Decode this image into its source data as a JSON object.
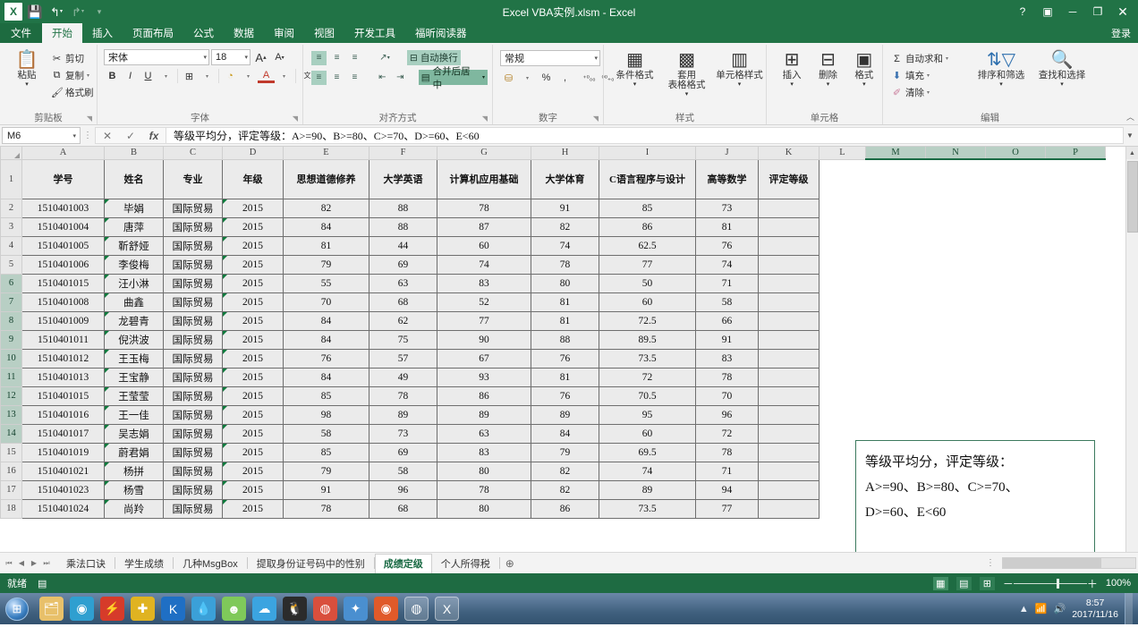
{
  "titlebar": {
    "app_icon": "excel-logo",
    "quick_access": [
      "save-icon",
      "undo-icon",
      "redo-icon",
      "customize-qat-icon"
    ],
    "title": "Excel VBA实例.xlsm - Excel",
    "help": "?",
    "ribbon_display": "▣",
    "minimize": "－",
    "restore": "❐",
    "close": "✕"
  },
  "ribbon": {
    "file_tab": "文件",
    "tabs": [
      "开始",
      "插入",
      "页面布局",
      "公式",
      "数据",
      "审阅",
      "视图",
      "开发工具",
      "福昕阅读器"
    ],
    "active_tab": "开始",
    "signin": "登录",
    "groups": {
      "clipboard": {
        "label": "剪贴板",
        "paste": "粘贴",
        "cut": "剪切",
        "copy": "复制",
        "format_painter": "格式刷"
      },
      "font": {
        "label": "字体",
        "font_name": "宋体",
        "font_size": "18",
        "grow": "A",
        "shrink": "A",
        "bold": "B",
        "italic": "I",
        "underline": "U",
        "border": "⊞",
        "fill": "🎨",
        "font_color": "A",
        "phonetic": "wén"
      },
      "alignment": {
        "label": "对齐方式",
        "wrap_text": "自动换行",
        "merge_center": "合并后居中",
        "orientation": "↗"
      },
      "number": {
        "label": "数字",
        "format": "常规",
        "accounting": "¤",
        "percent": "%",
        "comma": ",",
        "increase_decimal": "←.0",
        "decrease_decimal": ".00→"
      },
      "styles": {
        "label": "样式",
        "conditional_formatting": "条件格式",
        "format_as_table": "套用\n表格格式",
        "cell_styles": "单元格样式"
      },
      "cells": {
        "label": "单元格",
        "insert": "插入",
        "delete": "删除",
        "format": "格式"
      },
      "editing": {
        "label": "编辑",
        "autosum": "自动求和",
        "fill": "填充",
        "clear": "清除",
        "sort_filter": "排序和筛选",
        "find_select": "查找和选择",
        "collapse": "︿"
      }
    }
  },
  "formula_bar": {
    "name_box": "M6",
    "cancel": "✕",
    "enter": "✓",
    "insert_function": "fx",
    "content": "等级平均分，评定等级：A>=90、B>=80、C>=70、D>=60、E<60",
    "expand": "▼"
  },
  "grid": {
    "columns": [
      "A",
      "B",
      "C",
      "D",
      "E",
      "F",
      "G",
      "H",
      "I",
      "J",
      "K",
      "L",
      "M",
      "N",
      "O",
      "P"
    ],
    "selected_columns": [
      "M",
      "N",
      "O",
      "P"
    ],
    "selected_rows": [
      "6",
      "7",
      "8",
      "9",
      "10",
      "11",
      "12",
      "13",
      "14"
    ],
    "headers": [
      "学号",
      "姓名",
      "专业",
      "年级",
      "思想道德修养",
      "大学英语",
      "计算机应用基础",
      "大学体育",
      "C语言程序与设计",
      "高等数学",
      "评定等级"
    ],
    "rows": [
      {
        "n": "2",
        "cells": [
          "1510401003",
          "毕娟",
          "国际贸易",
          "2015",
          "82",
          "88",
          "78",
          "91",
          "85",
          "73",
          ""
        ]
      },
      {
        "n": "3",
        "cells": [
          "1510401004",
          "唐萍",
          "国际贸易",
          "2015",
          "84",
          "88",
          "87",
          "82",
          "86",
          "81",
          ""
        ]
      },
      {
        "n": "4",
        "cells": [
          "1510401005",
          "靳舒娅",
          "国际贸易",
          "2015",
          "81",
          "44",
          "60",
          "74",
          "62.5",
          "76",
          ""
        ]
      },
      {
        "n": "5",
        "cells": [
          "1510401006",
          "李俊梅",
          "国际贸易",
          "2015",
          "79",
          "69",
          "74",
          "78",
          "77",
          "74",
          ""
        ]
      },
      {
        "n": "6",
        "cells": [
          "1510401015",
          "汪小淋",
          "国际贸易",
          "2015",
          "55",
          "63",
          "83",
          "80",
          "50",
          "71",
          ""
        ]
      },
      {
        "n": "7",
        "cells": [
          "1510401008",
          "曲鑫",
          "国际贸易",
          "2015",
          "70",
          "68",
          "52",
          "81",
          "60",
          "58",
          ""
        ]
      },
      {
        "n": "8",
        "cells": [
          "1510401009",
          "龙碧青",
          "国际贸易",
          "2015",
          "84",
          "62",
          "77",
          "81",
          "72.5",
          "66",
          ""
        ]
      },
      {
        "n": "9",
        "cells": [
          "1510401011",
          "倪洪波",
          "国际贸易",
          "2015",
          "84",
          "75",
          "90",
          "88",
          "89.5",
          "91",
          ""
        ]
      },
      {
        "n": "10",
        "cells": [
          "1510401012",
          "王玉梅",
          "国际贸易",
          "2015",
          "76",
          "57",
          "67",
          "76",
          "73.5",
          "83",
          ""
        ]
      },
      {
        "n": "11",
        "cells": [
          "1510401013",
          "王宝静",
          "国际贸易",
          "2015",
          "84",
          "49",
          "93",
          "81",
          "72",
          "78",
          ""
        ]
      },
      {
        "n": "12",
        "cells": [
          "1510401015",
          "王莹莹",
          "国际贸易",
          "2015",
          "85",
          "78",
          "86",
          "76",
          "70.5",
          "70",
          ""
        ]
      },
      {
        "n": "13",
        "cells": [
          "1510401016",
          "王一佳",
          "国际贸易",
          "2015",
          "98",
          "89",
          "89",
          "89",
          "95",
          "96",
          ""
        ]
      },
      {
        "n": "14",
        "cells": [
          "1510401017",
          "吴志娟",
          "国际贸易",
          "2015",
          "58",
          "73",
          "63",
          "84",
          "60",
          "72",
          ""
        ]
      },
      {
        "n": "15",
        "cells": [
          "1510401019",
          "蔚君娟",
          "国际贸易",
          "2015",
          "85",
          "69",
          "83",
          "79",
          "69.5",
          "78",
          ""
        ]
      },
      {
        "n": "16",
        "cells": [
          "1510401021",
          "杨拼",
          "国际贸易",
          "2015",
          "79",
          "58",
          "80",
          "82",
          "74",
          "71",
          ""
        ]
      },
      {
        "n": "17",
        "cells": [
          "1510401023",
          "杨雪",
          "国际贸易",
          "2015",
          "91",
          "96",
          "78",
          "82",
          "89",
          "94",
          ""
        ]
      },
      {
        "n": "18",
        "cells": [
          "1510401024",
          "尚羚",
          "国际贸易",
          "2015",
          "78",
          "68",
          "80",
          "86",
          "73.5",
          "77",
          ""
        ]
      }
    ],
    "textbox": "等级平均分，评定等级：\nA>=90、B>=80、C>=70、\nD>=60、E<60"
  },
  "sheet_tabs": {
    "first": "⏮",
    "prev": "◀",
    "next": "▶",
    "last": "⏭",
    "tabs": [
      "乘法口诀",
      "学生成绩",
      "几种MsgBox",
      "提取身份证号码中的性别",
      "成绩定级",
      "个人所得税"
    ],
    "active": "成绩定级",
    "add": "⊕",
    "more": "⋮"
  },
  "status_bar": {
    "mode": "就绪",
    "macro_icon": "record-macro-icon",
    "view_normal": "▦",
    "view_layout": "▤",
    "view_pagebreak": "⊞",
    "zoom_out": "－",
    "zoom_in": "＋",
    "zoom": "100%"
  },
  "taskbar": {
    "start": "start-orb",
    "items": [
      {
        "name": "file-explorer",
        "glyph": "🗂",
        "color": "#e8c06a"
      },
      {
        "name": "media-player",
        "glyph": "◉",
        "color": "#2f9fd0"
      },
      {
        "name": "thunder-download",
        "glyph": "⚡",
        "color": "#d63b2a"
      },
      {
        "name": "360-safe",
        "glyph": "✚",
        "color": "#e0b321"
      },
      {
        "name": "kingsoft",
        "glyph": "K",
        "color": "#1f6fc4"
      },
      {
        "name": "water-app",
        "glyph": "💧",
        "color": "#3ba0d8"
      },
      {
        "name": "ghost-app",
        "glyph": "☻",
        "color": "#7fc95a"
      },
      {
        "name": "baidu-cloud",
        "glyph": "☁",
        "color": "#3ba4e0"
      },
      {
        "name": "qq-messenger",
        "glyph": "🐧",
        "color": "#2b2b2b"
      },
      {
        "name": "chrome-browser",
        "glyph": "◍",
        "color": "#d94f3d"
      },
      {
        "name": "foxmail",
        "glyph": "✦",
        "color": "#4a8fd0"
      },
      {
        "name": "media-firefox",
        "glyph": "◉",
        "color": "#e05a2a"
      },
      {
        "name": "chrome-window",
        "glyph": "◍",
        "color": "#d94f3d"
      },
      {
        "name": "excel-window",
        "glyph": "X",
        "color": "#217346"
      }
    ],
    "tray": [
      "▲",
      "📶",
      "🔊"
    ],
    "time": "8:57",
    "date": "2017/11/16"
  }
}
